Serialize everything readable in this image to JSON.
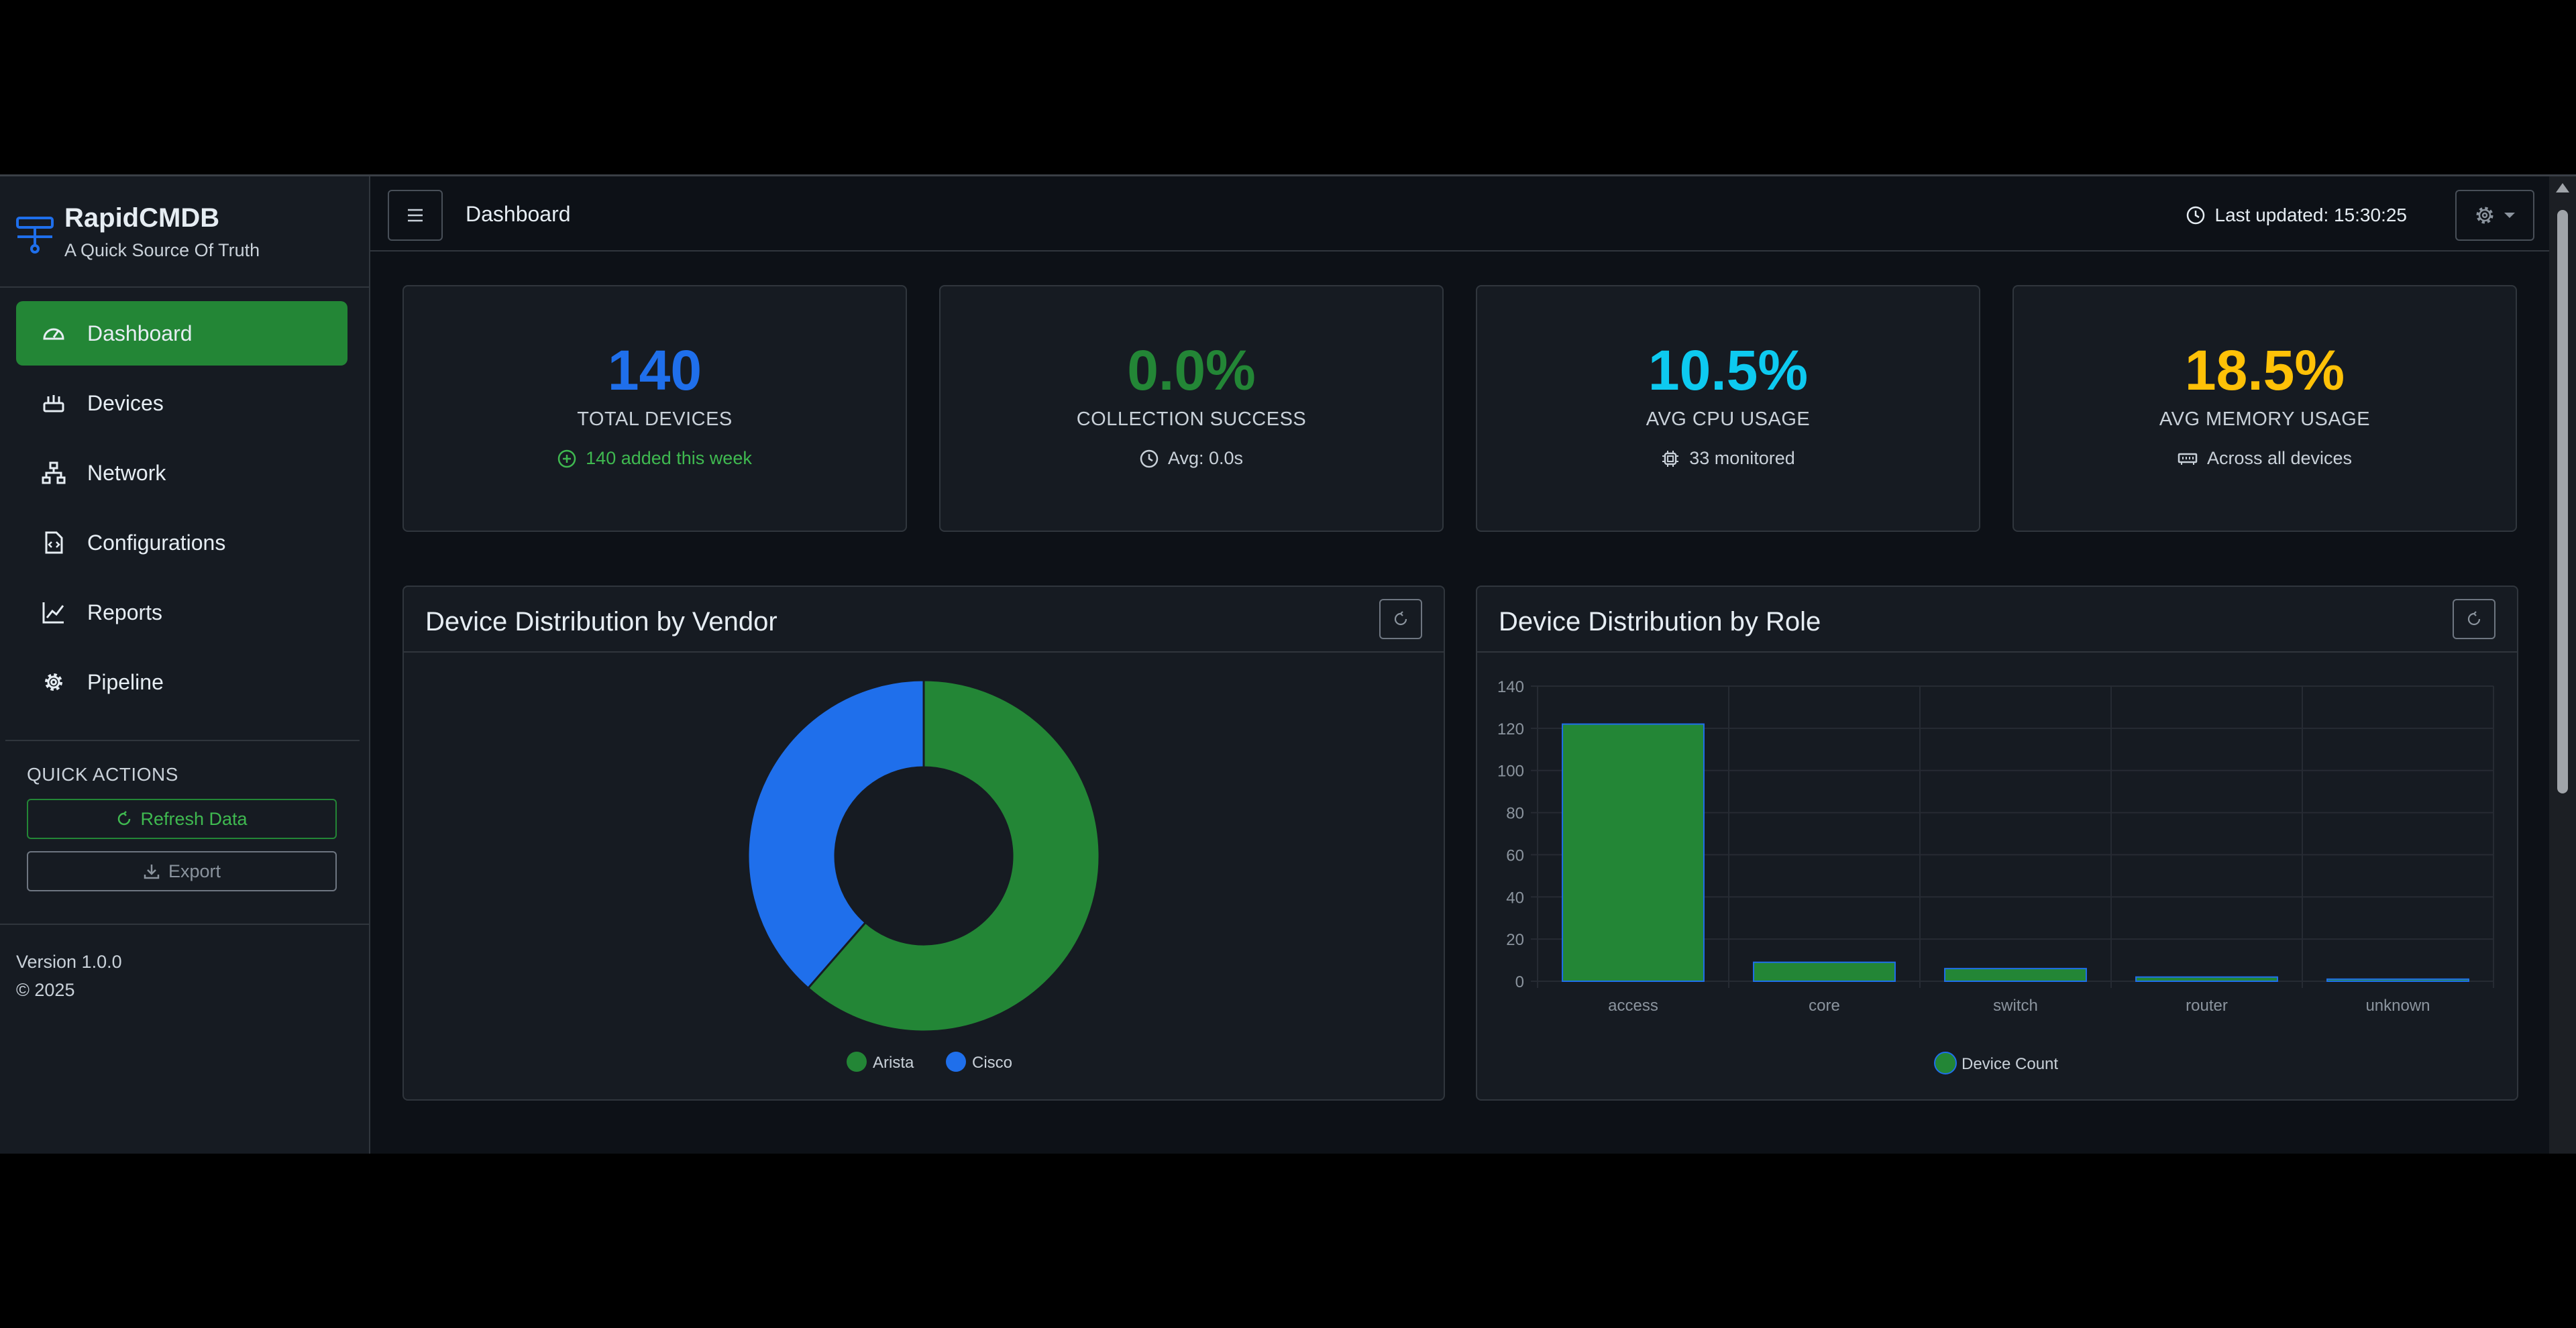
{
  "brand": {
    "title": "RapidCMDB",
    "subtitle": "A Quick Source Of Truth",
    "icon": "network-server-icon"
  },
  "sidebar": {
    "items": [
      {
        "label": "Dashboard",
        "icon": "speedometer-icon",
        "active": true
      },
      {
        "label": "Devices",
        "icon": "devices-icon",
        "active": false
      },
      {
        "label": "Network",
        "icon": "diagram-icon",
        "active": false
      },
      {
        "label": "Configurations",
        "icon": "file-code-icon",
        "active": false
      },
      {
        "label": "Reports",
        "icon": "line-chart-icon",
        "active": false
      },
      {
        "label": "Pipeline",
        "icon": "gear-icon",
        "active": false
      }
    ],
    "quick_actions": {
      "title": "QUICK ACTIONS",
      "refresh_label": "Refresh Data",
      "export_label": "Export"
    },
    "version": "Version 1.0.0",
    "copyright": "© 2025"
  },
  "header": {
    "title": "Dashboard",
    "last_updated": "Last updated: 15:30:25"
  },
  "stats": [
    {
      "value": "140",
      "label": "TOTAL DEVICES",
      "sub": "140 added this week",
      "color": "#1f6feb",
      "sub_color": "#3fb950",
      "icon": "plus-circle-icon"
    },
    {
      "value": "0.0%",
      "label": "COLLECTION SUCCESS",
      "sub": "Avg: 0.0s",
      "color": "#238636",
      "sub_color": "#c9d1d9",
      "icon": "clock-icon"
    },
    {
      "value": "10.5%",
      "label": "AVG CPU USAGE",
      "sub": "33 monitored",
      "color": "#0dcaf0",
      "sub_color": "#c9d1d9",
      "icon": "cpu-icon"
    },
    {
      "value": "18.5%",
      "label": "AVG MEMORY USAGE",
      "sub": "Across all devices",
      "color": "#ffc107",
      "sub_color": "#c9d1d9",
      "icon": "memory-icon"
    }
  ],
  "cards": {
    "vendor_title": "Device Distribution by Vendor",
    "role_title": "Device Distribution by Role"
  },
  "chart_data": [
    {
      "type": "pie",
      "title": "Device Distribution by Vendor",
      "categories": [
        "Arista",
        "Cisco"
      ],
      "values": [
        86,
        54
      ],
      "colors": [
        "#238636",
        "#1f6feb"
      ],
      "legend": "bottom"
    },
    {
      "type": "bar",
      "title": "Device Distribution by Role",
      "categories": [
        "access",
        "core",
        "switch",
        "router",
        "unknown"
      ],
      "series": [
        {
          "name": "Device Count",
          "values": [
            122,
            9,
            6,
            2,
            1
          ]
        }
      ],
      "ylim": [
        0,
        140
      ],
      "yticks": [
        0,
        20,
        40,
        60,
        80,
        100,
        120,
        140
      ],
      "colors": {
        "fill": "#238636",
        "stroke": "#1f6feb"
      },
      "grid": true,
      "legend": "bottom"
    }
  ]
}
